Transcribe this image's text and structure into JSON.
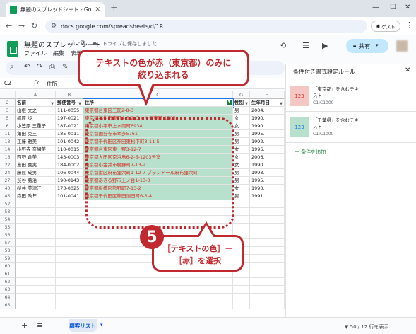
{
  "browser": {
    "tab_title": "無題のスプレッドシート - Google ス",
    "url": "docs.google.com/spreadsheets/d/1R",
    "guest_label": "ゲスト"
  },
  "doc": {
    "title": "無題のスプレッドシート",
    "saved_status": "ドライブに保存しました",
    "menus": [
      "ファイル",
      "編集",
      "表示"
    ],
    "share_label": "共有"
  },
  "formula_bar": {
    "cell_ref": "C2",
    "fx": "fx",
    "value": "住所"
  },
  "sheet": {
    "columns": [
      "A",
      "B",
      "C",
      "G",
      "H"
    ],
    "headers": [
      "名前",
      "郵便番号",
      "住所",
      "性別",
      "生年月日"
    ],
    "rows": [
      {
        "num": "2",
        "name": "",
        "zip": "",
        "addr": "",
        "sex": "",
        "dob": "",
        "header": true
      },
      {
        "num": "3",
        "name": "山根 文之",
        "zip": "111-0055",
        "addr": "東京都台東区三筋2-8-3",
        "sex": "男",
        "dob": "2004."
      },
      {
        "num": "5",
        "name": "梶原 歩",
        "zip": "197-0021",
        "addr": "東京都福生市東町4-6-2 フォルテ東町 1505",
        "sex": "女",
        "dob": "1990."
      },
      {
        "num": "6",
        "name": "小笠原 三重子",
        "zip": "187-0021",
        "addr": "東京都小平市上水南町6934",
        "sex": "女",
        "dob": "1990."
      },
      {
        "num": "11",
        "name": "角田 克三",
        "zip": "185-0011",
        "addr": "東京都国分寺市本多5761",
        "sex": "男",
        "dob": "1995."
      },
      {
        "num": "13",
        "name": "工藤 雅美",
        "zip": "101-0042",
        "addr": "東京都千代田区神田東松下町3-11-5",
        "sex": "男",
        "dob": "1992."
      },
      {
        "num": "14",
        "name": "小野寺 奈緒美",
        "zip": "110-0015",
        "addr": "東京都台東区東上野3-12-7",
        "sex": "女",
        "dob": "1996."
      },
      {
        "num": "16",
        "name": "西野 倉美",
        "zip": "143-0003",
        "addr": "東京都大田区京浜島6-2-6-1203号室",
        "sex": "女",
        "dob": "2006."
      },
      {
        "num": "22",
        "name": "島田 喜実",
        "zip": "184-0002",
        "addr": "東京都小金井市梶野町7-13-2",
        "sex": "女",
        "dob": "1990."
      },
      {
        "num": "24",
        "name": "藤原 成男",
        "zip": "106-0044",
        "addr": "東京都港区麻布狸穴町1-12-7 ブランドール麻布狸穴町",
        "sex": "男",
        "dob": "1993."
      },
      {
        "num": "27",
        "name": "渋谷 菊治",
        "zip": "190-0143",
        "addr": "東京都あきる野市上ノ台1-13-3",
        "sex": "男",
        "dob": "1995."
      },
      {
        "num": "40",
        "name": "桜井 美津江",
        "zip": "173-0025",
        "addr": "東京都板橋区熊野町7-13-2",
        "sex": "女",
        "dob": "1990."
      },
      {
        "num": "45",
        "name": "森田 政年",
        "zip": "101-0041",
        "addr": "東京都千代田区神田須田町6-3-4",
        "sex": "男",
        "dob": "1991."
      },
      {
        "num": "52",
        "name": "",
        "zip": "",
        "addr": "",
        "sex": "",
        "dob": ""
      },
      {
        "num": "53",
        "name": "",
        "zip": "",
        "addr": "",
        "sex": "",
        "dob": ""
      },
      {
        "num": "54",
        "name": "",
        "zip": "",
        "addr": "",
        "sex": "",
        "dob": ""
      },
      {
        "num": "55",
        "name": "",
        "zip": "",
        "addr": "",
        "sex": "",
        "dob": ""
      },
      {
        "num": "56",
        "name": "",
        "zip": "",
        "addr": "",
        "sex": "",
        "dob": ""
      },
      {
        "num": "57",
        "name": "",
        "zip": "",
        "addr": "",
        "sex": "",
        "dob": ""
      },
      {
        "num": "58",
        "name": "",
        "zip": "",
        "addr": "",
        "sex": "",
        "dob": ""
      },
      {
        "num": "59",
        "name": "",
        "zip": "",
        "addr": "",
        "sex": "",
        "dob": ""
      },
      {
        "num": "60",
        "name": "",
        "zip": "",
        "addr": "",
        "sex": "",
        "dob": ""
      },
      {
        "num": "61",
        "name": "",
        "zip": "",
        "addr": "",
        "sex": "",
        "dob": ""
      },
      {
        "num": "62",
        "name": "",
        "zip": "",
        "addr": "",
        "sex": "",
        "dob": ""
      },
      {
        "num": "63",
        "name": "",
        "zip": "",
        "addr": "",
        "sex": "",
        "dob": ""
      },
      {
        "num": "64",
        "name": "",
        "zip": "",
        "addr": "",
        "sex": "",
        "dob": ""
      },
      {
        "num": "65",
        "name": "",
        "zip": "",
        "addr": "",
        "sex": "",
        "dob": ""
      }
    ]
  },
  "sheet_tabs": {
    "active": "顧客リスト",
    "status": "50 / 12 行を表示"
  },
  "panel": {
    "title": "条件付き書式設定ルール",
    "rules": [
      {
        "sample": "123",
        "text": "「東京都」を含むテキスト",
        "range": "C1:C1000",
        "bg": "#f4c7c3",
        "fg": "#d93025"
      },
      {
        "sample": "123",
        "text": "「千葉県」を含むテキスト",
        "range": "C1:C1000",
        "bg": "#b7e1cd",
        "fg": "#1a73e8"
      }
    ],
    "add_rule": "条件を追加"
  },
  "annotations": {
    "callout_top_line1": "テキストの色が赤（東京都）のみに",
    "callout_top_line2": "絞り込まれる",
    "step_number": "5",
    "callout_bottom_line1": "［テキストの色］－",
    "callout_bottom_line2": "［赤］を選択"
  }
}
